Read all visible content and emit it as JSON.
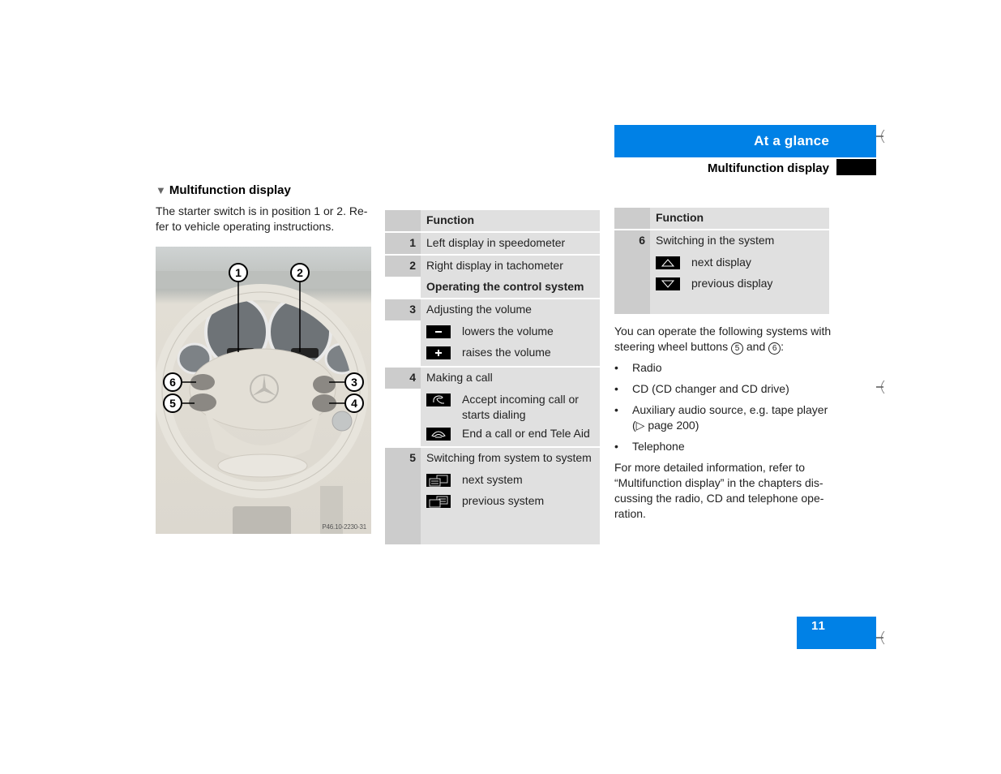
{
  "header": {
    "chapter": "At a glance",
    "section": "Multifunction display"
  },
  "left": {
    "title_marker": "▼",
    "title": "Multifunction display",
    "intro": "The starter switch is in position 1 or 2. Re-fer to vehicle operating instructions.",
    "photo_code": "P46.10-2230-31",
    "callouts": [
      "1",
      "2",
      "3",
      "4",
      "5",
      "6"
    ]
  },
  "table1": {
    "header": "Function",
    "rows": [
      {
        "num": "1",
        "lines": [
          {
            "text": "Left display in speedometer"
          }
        ]
      },
      {
        "num": "2",
        "lines": [
          {
            "text": "Right display in tachometer"
          },
          {
            "text": "Operating the control system",
            "bold": true
          }
        ]
      },
      {
        "num": "3",
        "title": "Adjusting the volume",
        "items": [
          {
            "icon": "minus-icon",
            "text": "lowers the volume"
          },
          {
            "icon": "plus-icon",
            "text": "raises the volume"
          }
        ]
      },
      {
        "num": "4",
        "title": "Making a call",
        "items": [
          {
            "icon": "phone-pickup-icon",
            "text": "Accept incoming call or starts dialing"
          },
          {
            "icon": "phone-hangup-icon",
            "text": "End a call or end Tele Aid"
          }
        ]
      },
      {
        "num": "5",
        "title": "Switching from system to system",
        "items": [
          {
            "icon": "next-system-icon",
            "text": "next system"
          },
          {
            "icon": "previous-system-icon",
            "text": "previous system"
          }
        ]
      }
    ]
  },
  "table2": {
    "header": "Function",
    "rows": [
      {
        "num": "6",
        "title": "Switching in the system",
        "items": [
          {
            "icon": "arrow-up-icon",
            "text": "next display"
          },
          {
            "icon": "arrow-down-icon",
            "text": "previous display"
          }
        ]
      }
    ]
  },
  "right": {
    "intro_before": "You can operate the following systems with steering wheel buttons ",
    "btn_a": "5",
    "intro_and": " and ",
    "btn_b": "6",
    "intro_after": ":",
    "bullet": "•",
    "list": [
      "Radio",
      "CD (CD changer and CD drive)",
      "Auxiliary audio source, e.g. tape player (▷ page 200)",
      "Telephone"
    ],
    "footer": "For more detailed information, refer to “Multifunction display” in the chapters dis-cussing the radio, CD and telephone ope-ration."
  },
  "page_number": "11",
  "colors": {
    "accent_blue": "#0081e6",
    "table_cell": "#e0e0e0",
    "table_num": "#cccccc"
  }
}
